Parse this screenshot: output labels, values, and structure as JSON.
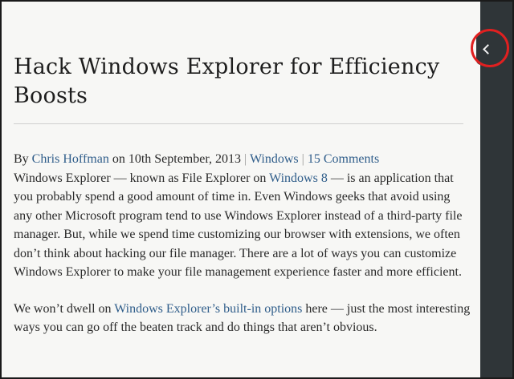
{
  "article": {
    "title": "Hack Windows Explorer for Efficiency Boosts",
    "byline": {
      "by": "By ",
      "author": "Chris Hoffman",
      "on": " on 10th September, 2013 ",
      "sep1": "|",
      "category": "Windows",
      "sep2": " | ",
      "comments": "15 Comments"
    },
    "p1": {
      "t1": "Windows Explorer — known as File Explorer on ",
      "link": "Windows 8",
      "t2": " — is an application that you probably spend a good amount of time in. Even Windows geeks that avoid using any other Microsoft program tend to use Windows Explorer instead of a third-party file manager. But, while we spend time customizing our browser with extensions, we often don’t think about hacking our file manager. There are a lot of ways you can customize Windows Explorer to make your file management experience faster and more efficient."
    },
    "p2": {
      "t1": "We won’t dwell on ",
      "link": "Windows Explorer’s built-in options",
      "t2": " here — just the most interesting ways you can go off the beaten track and do things that aren’t obvious."
    }
  },
  "sidebar": {
    "toggle_icon": "chevron-left-icon",
    "highlight_color": "#e02020"
  },
  "colors": {
    "link": "#2f5d8a",
    "sidebar": "#2f3538",
    "background": "#f7f7f5"
  }
}
